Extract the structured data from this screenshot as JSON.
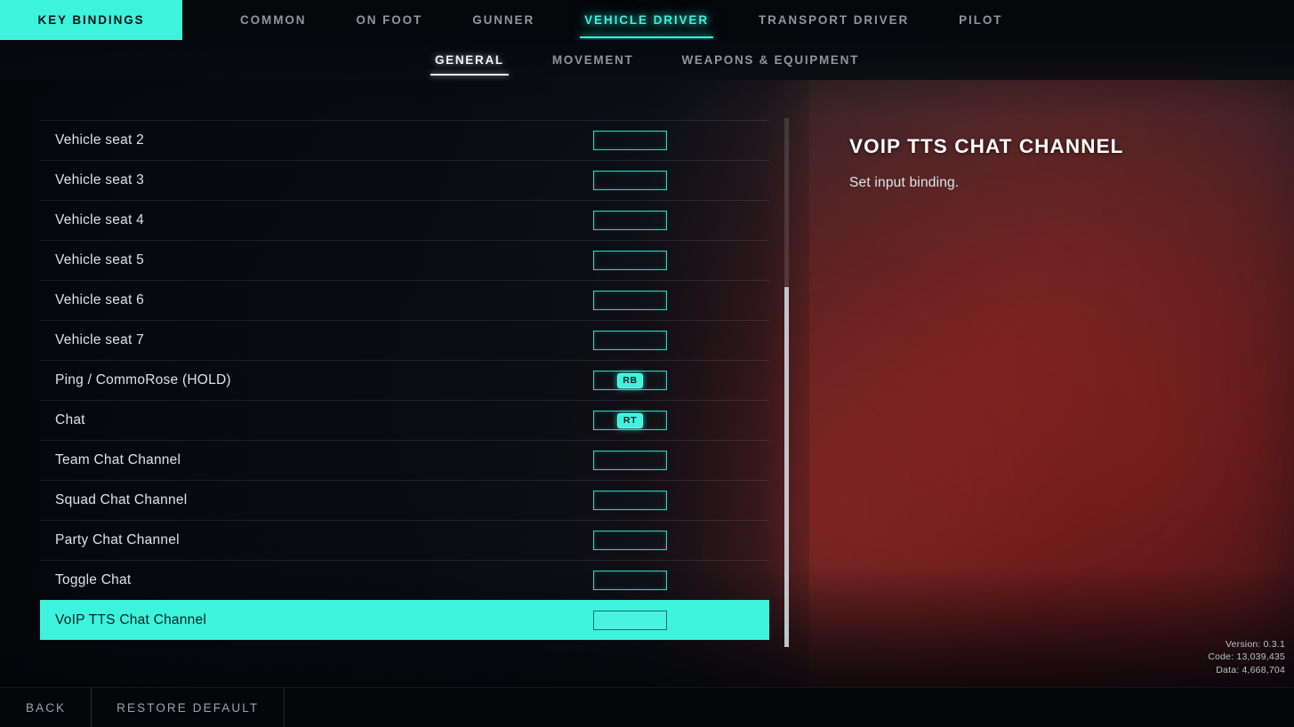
{
  "topnav": {
    "brand_label": "KEY BINDINGS",
    "tabs": [
      {
        "label": "COMMON",
        "active": false
      },
      {
        "label": "ON FOOT",
        "active": false
      },
      {
        "label": "GUNNER",
        "active": false
      },
      {
        "label": "VEHICLE DRIVER",
        "active": true
      },
      {
        "label": "TRANSPORT DRIVER",
        "active": false
      },
      {
        "label": "PILOT",
        "active": false
      }
    ]
  },
  "subnav": {
    "tabs": [
      {
        "label": "GENERAL",
        "active": true
      },
      {
        "label": "MOVEMENT",
        "active": false
      },
      {
        "label": "WEAPONS & EQUIPMENT",
        "active": false
      }
    ]
  },
  "bindings": {
    "rows": [
      {
        "label": "Vehicle seat 2",
        "key": "",
        "selected": false
      },
      {
        "label": "Vehicle seat 3",
        "key": "",
        "selected": false
      },
      {
        "label": "Vehicle seat 4",
        "key": "",
        "selected": false
      },
      {
        "label": "Vehicle seat 5",
        "key": "",
        "selected": false
      },
      {
        "label": "Vehicle seat 6",
        "key": "",
        "selected": false
      },
      {
        "label": "Vehicle seat 7",
        "key": "",
        "selected": false
      },
      {
        "label": "Ping / CommoRose (HOLD)",
        "key": "RB",
        "selected": false
      },
      {
        "label": "Chat",
        "key": "RT",
        "selected": false
      },
      {
        "label": "Team Chat Channel",
        "key": "",
        "selected": false
      },
      {
        "label": "Squad Chat Channel",
        "key": "",
        "selected": false
      },
      {
        "label": "Party Chat Channel",
        "key": "",
        "selected": false
      },
      {
        "label": "Toggle Chat",
        "key": "",
        "selected": false
      },
      {
        "label": "VoIP TTS Chat Channel",
        "key": "",
        "selected": true
      }
    ]
  },
  "detail": {
    "title": "VOIP TTS CHAT CHANNEL",
    "description": "Set input binding."
  },
  "version_info": {
    "version": "Version: 0.3.1",
    "code": "Code: 13,039,435",
    "data": "Data: 4,668,704"
  },
  "bottombar": {
    "buttons": [
      {
        "label": "BACK"
      },
      {
        "label": "RESTORE DEFAULT"
      }
    ]
  },
  "colors": {
    "accent": "#3df3de",
    "background": "#05070a",
    "text_primary": "#d9e4ea",
    "text_muted": "#8d979e"
  }
}
